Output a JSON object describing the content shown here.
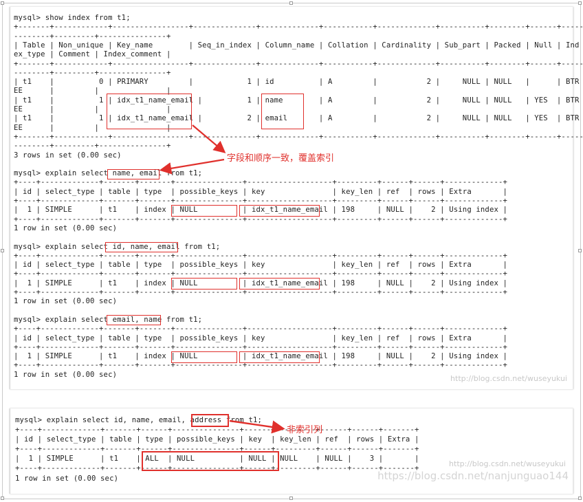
{
  "panel1": {
    "lines": [
      "mysql> show index from t1;",
      "+-------+------------+-----------------+--------------+-------------+-----------+-------------+----------+--------+------+-----",
      "--------+---------+---------------+",
      "| Table | Non_unique | Key_name        | Seq_in_index | Column_name | Collation | Cardinality | Sub_part | Packed | Null | Ind",
      "ex_type | Comment | Index_comment |",
      "+-------+------------+-----------------+--------------+-------------+-----------+-------------+----------+--------+------+-----",
      "--------+---------+---------------+",
      "| t1    |          0 | PRIMARY         |            1 | id          | A         |           2 |     NULL | NULL   |      | BTR",
      "EE      |         |               |",
      "| t1    |          1 | idx_t1_name_email |          1 | name        | A         |           2 |     NULL | NULL   | YES  | BTR",
      "EE      |         |               |",
      "| t1    |          1 | idx_t1_name_email |          2 | email       | A         |           2 |     NULL | NULL   | YES  | BTR",
      "EE      |         |               |",
      "+-------+------------+-----------------+--------------+-------------+-----------+-------------+----------+--------+------+-----",
      "--------+---------+---------------+",
      "3 rows in set (0.00 sec)",
      "",
      "mysql> explain select name, email from t1;",
      "+----+-------------+-------+-------+---------------+-------------------+---------+------+------+-------------+",
      "| id | select_type | table | type  | possible_keys | key               | key_len | ref  | rows | Extra       |",
      "+----+-------------+-------+-------+---------------+-------------------+---------+------+------+-------------+",
      "|  1 | SIMPLE      | t1    | index | NULL          | idx_t1_name_email | 198     | NULL |    2 | Using index |",
      "+----+-------------+-------+-------+---------------+-------------------+---------+------+------+-------------+",
      "1 row in set (0.00 sec)",
      "",
      "mysql> explain select id, name, email from t1;",
      "+----+-------------+-------+-------+---------------+-------------------+---------+------+------+-------------+",
      "| id | select_type | table | type  | possible_keys | key               | key_len | ref  | rows | Extra       |",
      "+----+-------------+-------+-------+---------------+-------------------+---------+------+------+-------------+",
      "|  1 | SIMPLE      | t1    | index | NULL          | idx_t1_name_email | 198     | NULL |    2 | Using index |",
      "+----+-------------+-------+-------+---------------+-------------------+---------+------+------+-------------+",
      "1 row in set (0.00 sec)",
      "",
      "mysql> explain select email, name from t1;",
      "+----+-------------+-------+-------+---------------+-------------------+---------+------+------+-------------+",
      "| id | select_type | table | type  | possible_keys | key               | key_len | ref  | rows | Extra       |",
      "+----+-------------+-------+-------+---------------+-------------------+---------+------+------+-------------+",
      "|  1 | SIMPLE      | t1    | index | NULL          | idx_t1_name_email | 198     | NULL |    2 | Using index |",
      "+----+-------------+-------+-------+---------------+-------------------+---------+------+------+-------------+",
      "1 row in set (0.00 sec)"
    ],
    "annotation": "字段和顺序一致，覆盖索引",
    "watermark": "http://blog.csdn.net/wuseyukui"
  },
  "panel2": {
    "lines": [
      "mysql> explain select id, name, email, address from t1;",
      "+----+-------------+-------+------+---------------+------+---------+------+------+-------+",
      "| id | select_type | table | type | possible_keys | key  | key_len | ref  | rows | Extra |",
      "+----+-------------+-------+------+---------------+------+---------+------+------+-------+",
      "|  1 | SIMPLE      | t1    | ALL  | NULL          | NULL | NULL    | NULL |    3 |       |",
      "+----+-------------+-------+------+---------------+------+---------+------+------+-------+",
      "1 row in set (0.00 sec)"
    ],
    "annotation": "非索引列",
    "watermark": "http://blog.csdn.net/wuseyukui",
    "watermark2": "https://blog.csdn.net/nanjunguao144"
  },
  "colors": {
    "highlight": "#e0302c",
    "text": "#222222",
    "watermark": "#c8c8c8"
  }
}
